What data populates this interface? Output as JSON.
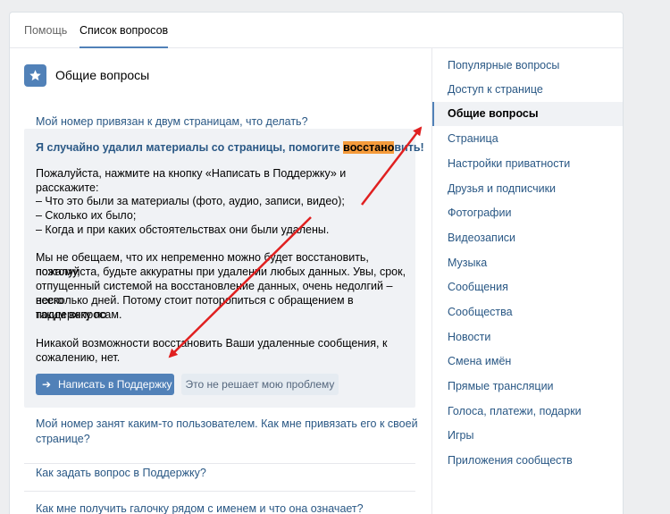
{
  "tabs": [
    {
      "label": "Помощь"
    },
    {
      "label": "Список вопросов"
    }
  ],
  "section": {
    "icon": "star-icon",
    "title": "Общие вопросы"
  },
  "questions": {
    "q1": "Мой номер привязан к двум страницам, что делать?",
    "q3_line1": "Мой номер занят каким-то пользователем. Как мне привязать его к своей",
    "q3_line2": "странице?",
    "q4": "Как задать вопрос в Поддержку?",
    "q5": "Как мне получить галочку рядом с именем и что она означает?"
  },
  "answer": {
    "title_before": "Я случайно удалил материалы со страницы, помогите ",
    "title_highlight": "восстано",
    "title_after": "вить!",
    "p1": "Пожалуйста, нажмите на кнопку «Написать в Поддержку» и расскажите:",
    "list": [
      "– Что это были за материалы (фото, аудио, записи, видео);",
      "– Сколько их было;",
      "– Когда и при каких обстоятельствах они были удалены."
    ],
    "p3": [
      "Мы не обещаем, что их непременно можно будет восстановить, поэтому,",
      "пожалуйста, будьте аккуратны при удалении любых данных. Увы, срок,",
      "отпущенный системой на восстановление данных, очень недолгий – всего",
      "несколько дней. Потому стоит поторопиться с обращением в поддержку по",
      "таким вопросам."
    ],
    "p4": [
      "Никакой возможности восстановить Ваши удаленные сообщения, к",
      "сожалению, нет."
    ],
    "btn_primary_icon": "arrow-right-icon",
    "btn_primary": "Написать в Поддержку",
    "btn_secondary": "Это не решает мою проблему"
  },
  "sidebar": {
    "items": [
      {
        "label": "Популярные вопросы"
      },
      {
        "label": "Доступ к странице"
      },
      {
        "label": "Общие вопросы",
        "active": true
      },
      {
        "label": "Страница"
      },
      {
        "label": "Настройки приватности"
      },
      {
        "label": "Друзья и подписчики"
      },
      {
        "label": "Фотографии"
      },
      {
        "label": "Видеозаписи"
      },
      {
        "label": "Музыка"
      },
      {
        "label": "Сообщения"
      },
      {
        "label": "Сообщества"
      },
      {
        "label": "Новости"
      },
      {
        "label": "Смена имён"
      },
      {
        "label": "Прямые трансляции"
      },
      {
        "label": "Голоса, платежи, подарки"
      },
      {
        "label": "Игры"
      },
      {
        "label": "Приложения сообществ"
      }
    ]
  },
  "colors": {
    "accent": "#5181b8",
    "link": "#2a5885",
    "highlight": "#f59b3b",
    "annotation_arrow": "#e02020"
  }
}
